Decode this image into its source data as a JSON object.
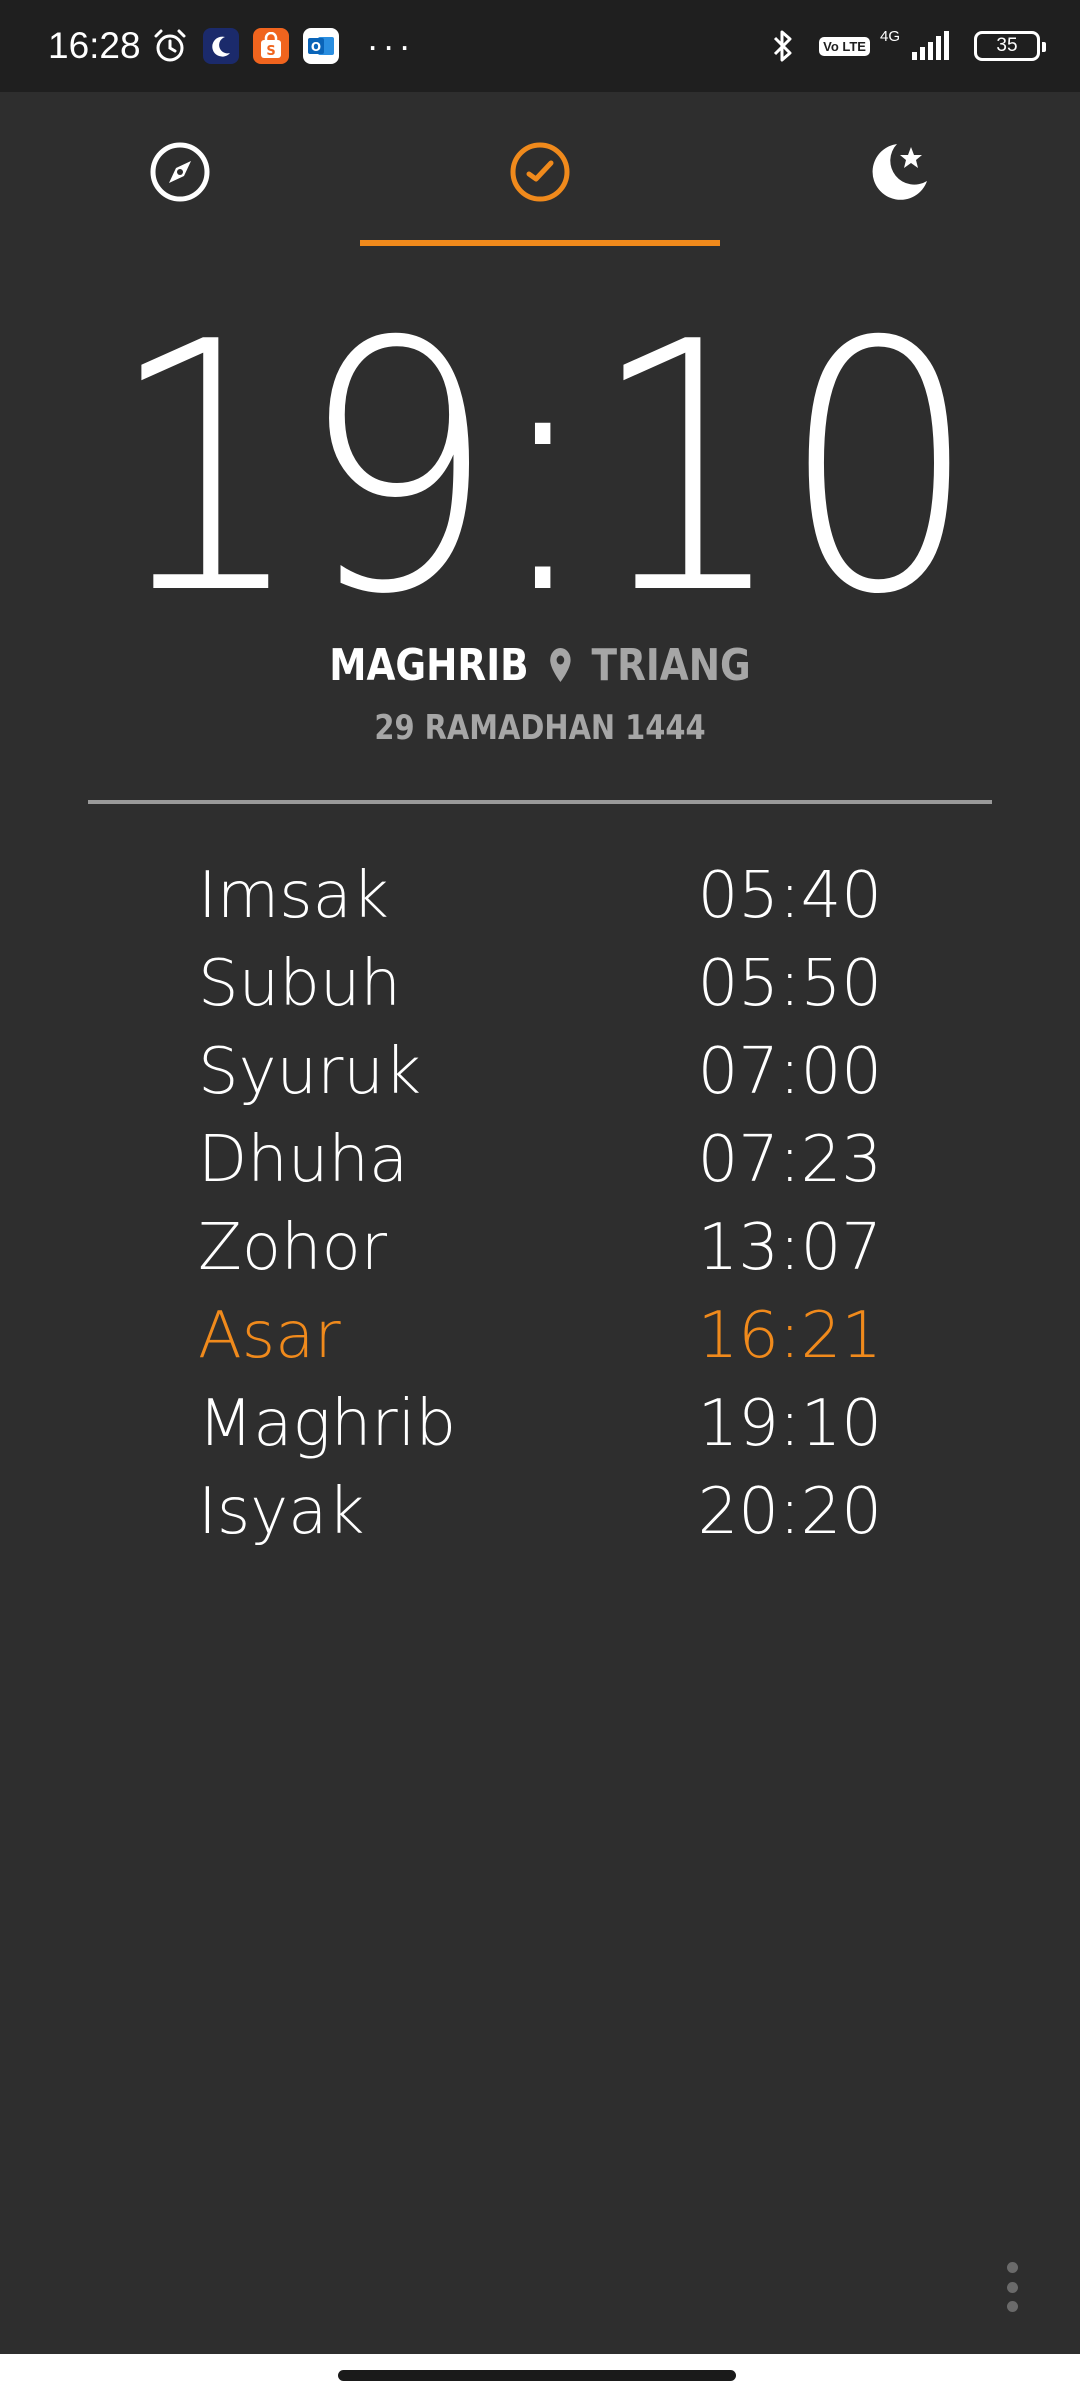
{
  "status_bar": {
    "time": "16:28",
    "icons": [
      "alarm-icon",
      "app-icon-crescent",
      "app-icon-shopee",
      "app-icon-outlook",
      "more-notifications-icon"
    ],
    "right_icons": [
      "bluetooth-icon",
      "volte-icon",
      "4g-icon",
      "signal-icon",
      "battery-icon"
    ],
    "volte_label": "Vo LTE",
    "network": "4G",
    "battery": "35"
  },
  "tabs": [
    {
      "id": "qibla",
      "icon": "compass-icon",
      "active": false
    },
    {
      "id": "times",
      "icon": "clock-icon",
      "active": true
    },
    {
      "id": "hijri",
      "icon": "crescent-star-icon",
      "active": false
    }
  ],
  "accent_color": "#f08a1c",
  "clock": {
    "time": "19:10",
    "prayer": "MAGHRIB",
    "location": "TRIANG",
    "hijri_date": "29 RAMADHAN 1444"
  },
  "prayer_times": [
    {
      "name": "Imsak",
      "time": "05:40",
      "active": false
    },
    {
      "name": "Subuh",
      "time": "05:50",
      "active": false
    },
    {
      "name": "Syuruk",
      "time": "07:00",
      "active": false
    },
    {
      "name": "Dhuha",
      "time": "07:23",
      "active": false
    },
    {
      "name": "Zohor",
      "time": "13:07",
      "active": false
    },
    {
      "name": "Asar",
      "time": "16:21",
      "active": true
    },
    {
      "name": "Maghrib",
      "time": "19:10",
      "active": false
    },
    {
      "name": "Isyak",
      "time": "20:20",
      "active": false
    }
  ]
}
